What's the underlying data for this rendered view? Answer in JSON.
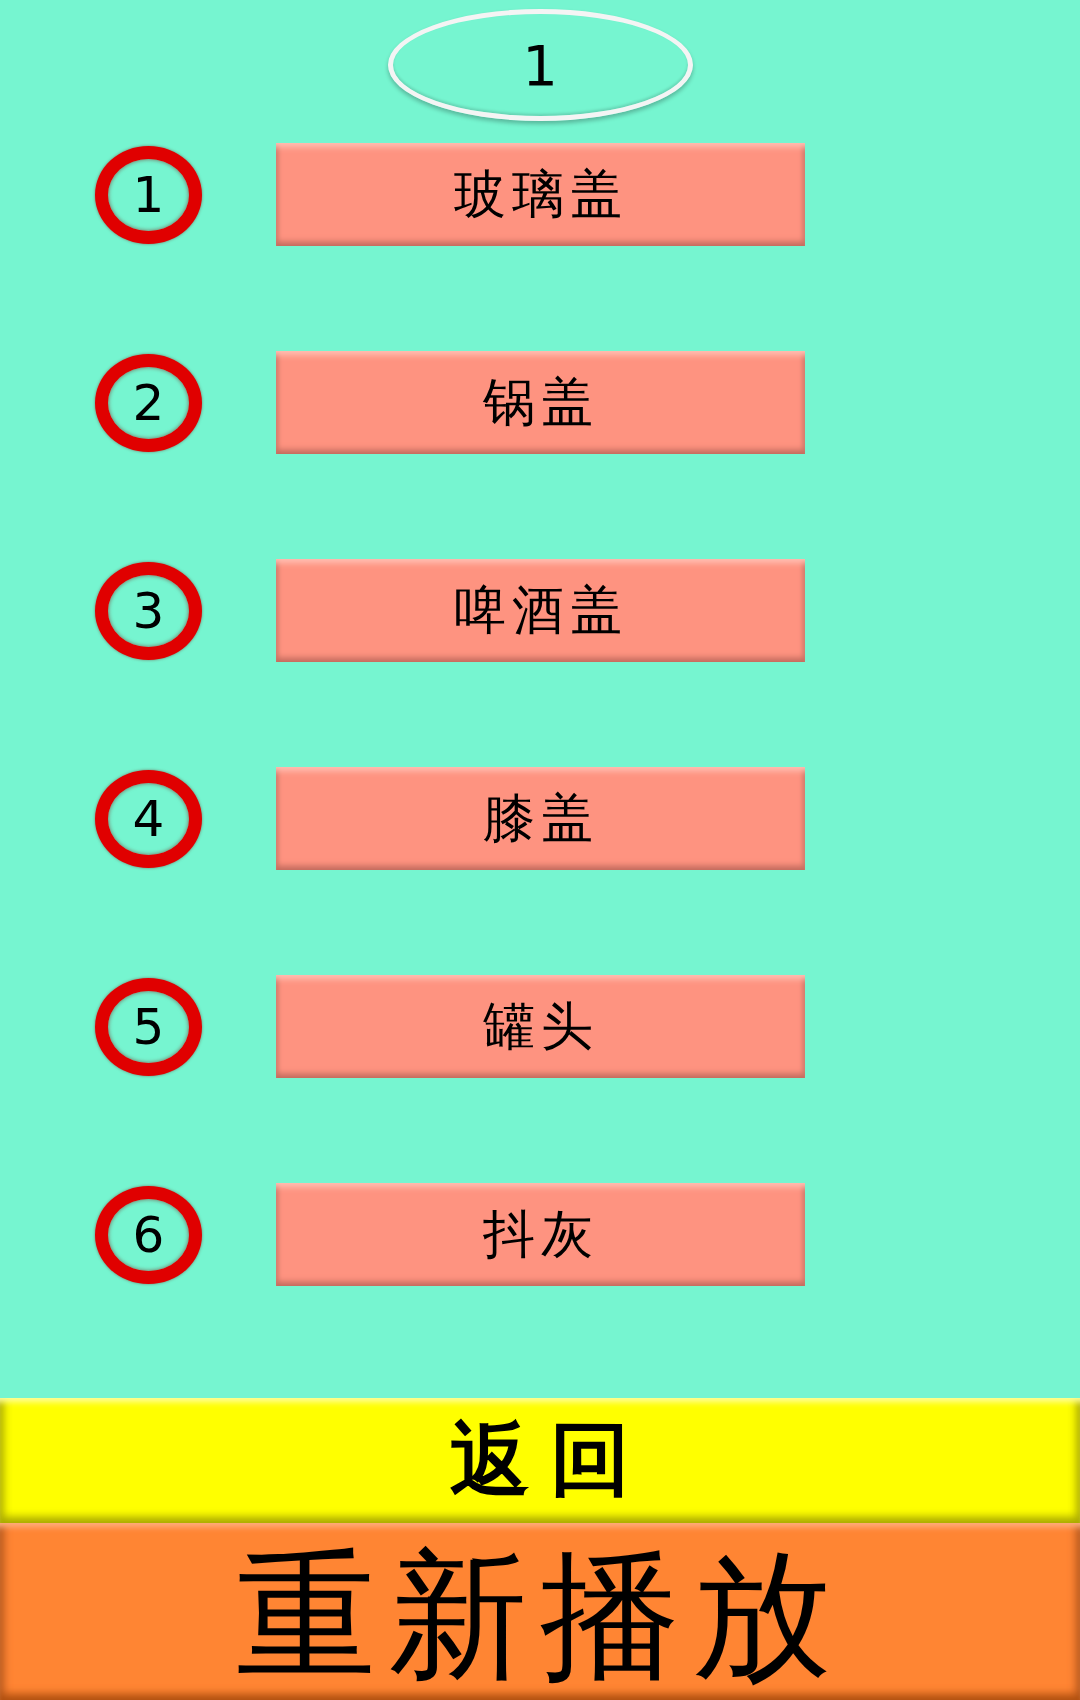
{
  "counter": "1",
  "items": [
    {
      "number": "1",
      "label": "玻璃盖"
    },
    {
      "number": "2",
      "label": "锅盖"
    },
    {
      "number": "3",
      "label": "啤酒盖"
    },
    {
      "number": "4",
      "label": "膝盖"
    },
    {
      "number": "5",
      "label": "罐头"
    },
    {
      "number": "6",
      "label": "抖灰"
    }
  ],
  "back_button": "返 回",
  "replay_button": "重新播放"
}
